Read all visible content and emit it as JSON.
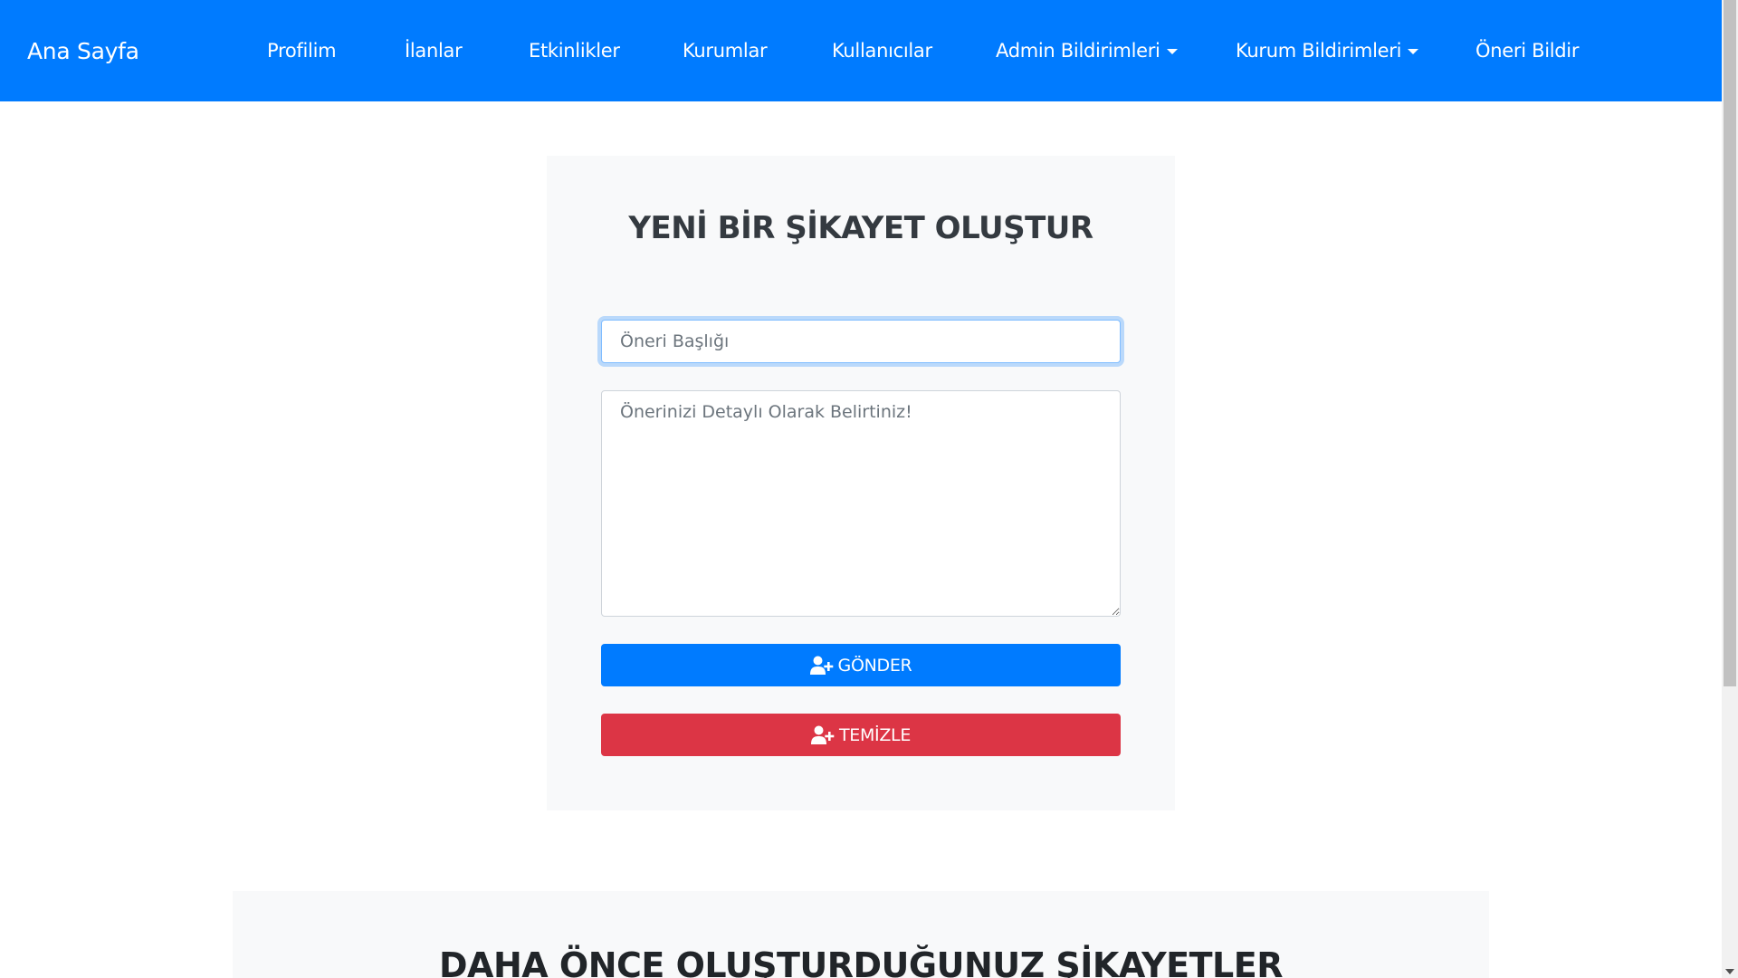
{
  "navbar": {
    "brand": "Ana Sayfa",
    "items": [
      {
        "label": "Profilim"
      },
      {
        "label": "İlanlar"
      },
      {
        "label": "Etkinlikler"
      },
      {
        "label": "Kurumlar"
      },
      {
        "label": "Kullanıcılar"
      },
      {
        "label": "Admin Bildirimleri",
        "dropdown": true
      },
      {
        "label": "Kurum Bildirimleri",
        "dropdown": true
      },
      {
        "label": "Öneri Bildir"
      }
    ]
  },
  "form": {
    "title": "YENİ BİR ŞİKAYET OLUŞTUR",
    "title_placeholder": "Öneri Başlığı",
    "detail_placeholder": "Önerinizi Detaylı Olarak Belirtiniz!",
    "send_label": "GÖNDER",
    "clear_label": "TEMİZLE"
  },
  "history": {
    "title": "DAHA ÖNCE OLUŞTURDUĞUNUZ ŞİKAYETLER"
  },
  "colors": {
    "primary": "#007bff",
    "danger": "#dc3545",
    "card_bg": "#f8f9fa"
  },
  "icons": {
    "button_icon": "user-plus-icon"
  }
}
